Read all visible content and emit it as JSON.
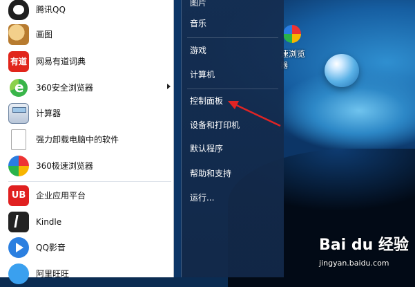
{
  "programs": [
    {
      "label": "腾讯QQ",
      "icon": "qq-penguin-icon"
    },
    {
      "label": "画图",
      "icon": "paint-palette-icon"
    },
    {
      "label": "网易有道词典",
      "icon": "youdao-dictionary-icon",
      "icon_text": "有道"
    },
    {
      "label": "360安全浏览器",
      "icon": "360-safe-browser-icon"
    },
    {
      "label": "计算器",
      "icon": "calculator-icon"
    },
    {
      "label": "强力卸载电脑中的软件",
      "icon": "file-icon"
    },
    {
      "label": "360极速浏览器",
      "icon": "360-speed-browser-icon"
    },
    {
      "label": "企业应用平台",
      "icon": "ub-platform-icon",
      "icon_text": "UB"
    },
    {
      "label": "Kindle",
      "icon": "kindle-icon"
    },
    {
      "label": "QQ影音",
      "icon": "qq-player-icon"
    },
    {
      "label": "阿里旺旺",
      "icon": "aliwangwang-icon"
    }
  ],
  "right_menu": [
    {
      "label": "图片"
    },
    {
      "label": "音乐"
    },
    {
      "label": "游戏"
    },
    {
      "label": "计算机"
    },
    {
      "label": "控制面板"
    },
    {
      "label": "设备和打印机"
    },
    {
      "label": "默认程序"
    },
    {
      "label": "帮助和支持"
    },
    {
      "label": "运行..."
    }
  ],
  "desktop_icon": {
    "label": "速浏览",
    "label2": "器"
  },
  "watermark": {
    "logo": "Bai du 经验",
    "url": "jingyan.baidu.com"
  },
  "colors": {
    "annotation": "#e02424",
    "menu_bg": "#1a3a66"
  }
}
